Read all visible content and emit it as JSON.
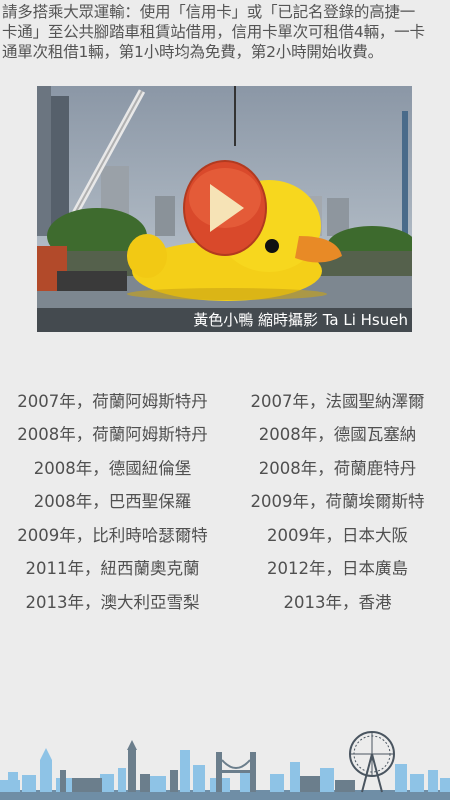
{
  "intro": {
    "line1": "請多搭乘大眾運輸：使用「信用卡」或「已記名登錄的高捷一",
    "line2": "卡通」至公共腳踏車租賃站借用，信用卡單次可租借4輛，一卡",
    "line3": "通單次租借1輛，第1小時均為免費，第2小時開始收費。"
  },
  "video": {
    "caption": "黃色小鴨 縮時攝影 Ta Li Hsueh",
    "play_icon": "play-icon"
  },
  "tour_list": {
    "left": [
      "2007年，荷蘭阿姆斯特丹",
      "2008年，荷蘭阿姆斯特丹",
      "2008年，德國紐倫堡",
      "2008年，巴西聖保羅",
      "2009年，比利時哈瑟爾特",
      "2011年，紐西蘭奧克蘭",
      "2013年，澳大利亞雪梨"
    ],
    "right": [
      "2007年，法國聖納澤爾",
      "2008年，德國瓦塞納",
      "2008年，荷蘭鹿特丹",
      "2009年，荷蘭埃爾斯特",
      "2009年，日本大阪",
      "2012年，日本廣島",
      "2013年，香港"
    ]
  },
  "colors": {
    "background": "#ececec",
    "play_button": "#d9492b",
    "duck": "#f7d21a",
    "skyline": "#8ec3e6"
  }
}
